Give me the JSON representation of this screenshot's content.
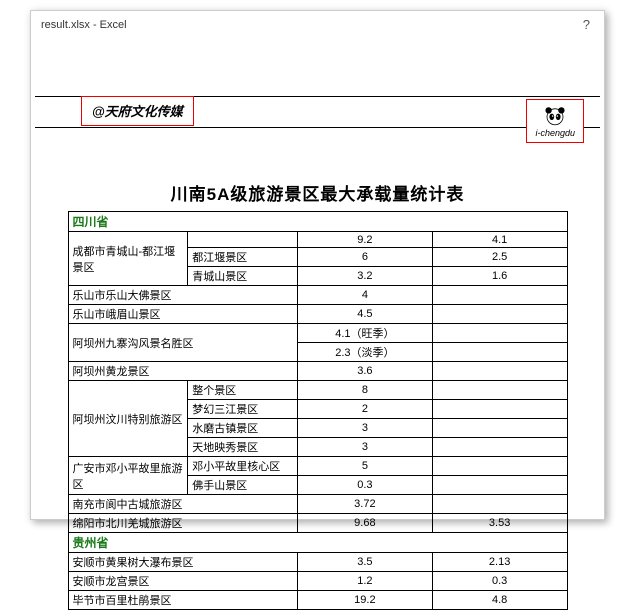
{
  "titlebar": {
    "filename": "result.xlsx - Excel",
    "help": "?"
  },
  "header": {
    "watermark": "@天府文化传媒",
    "logo_text": "i-chengdu",
    "doc_title": "川南5A级旅游景区最大承载量统计表"
  },
  "provinces": {
    "sichuan": "四川省",
    "guizhou": "贵州省"
  },
  "rows": {
    "r1": {
      "name": "成都市青城山-都江堰景区",
      "sub": "",
      "v1": "9.2",
      "v2": "4.1"
    },
    "r1a": {
      "sub": "都江堰景区",
      "v1": "6",
      "v2": "2.5"
    },
    "r1b": {
      "sub": "青城山景区",
      "v1": "3.2",
      "v2": "1.6"
    },
    "r2": {
      "name": "乐山市乐山大佛景区",
      "v1": "4",
      "v2": ""
    },
    "r3": {
      "name": "乐山市峨眉山景区",
      "v1": "4.5",
      "v2": ""
    },
    "r4": {
      "name": "阿坝州九寨沟风景名胜区",
      "v1": "4.1（旺季）",
      "v2": ""
    },
    "r4a": {
      "v1": "2.3（淡季）",
      "v2": ""
    },
    "r5": {
      "name": "阿坝州黄龙景区",
      "v1": "3.6",
      "v2": ""
    },
    "r6": {
      "name": "阿坝州汶川特别旅游区",
      "sub1": "整个景区",
      "v1_1": "8",
      "sub2": "梦幻三江景区",
      "v1_2": "2",
      "sub3": "水磨古镇景区",
      "v1_3": "3",
      "sub4": "天地映秀景区",
      "v1_4": "3"
    },
    "r7": {
      "name": "广安市邓小平故里旅游区",
      "sub1": "邓小平故里核心区",
      "v1_1": "5",
      "sub2": "佛手山景区",
      "v1_2": "0.3"
    },
    "r8": {
      "name": "南充市阆中古城旅游区",
      "v1": "3.72",
      "v2": ""
    },
    "r9": {
      "name": "绵阳市北川羌城旅游区",
      "v1": "9.68",
      "v2": "3.53"
    },
    "g1": {
      "name": "安顺市黄果树大瀑布景区",
      "v1": "3.5",
      "v2": "2.13"
    },
    "g2": {
      "name": "安顺市龙宫景区",
      "v1": "1.2",
      "v2": "0.3"
    },
    "g3": {
      "name": "毕节市百里杜鹃景区",
      "v1": "19.2",
      "v2": "4.8"
    }
  }
}
